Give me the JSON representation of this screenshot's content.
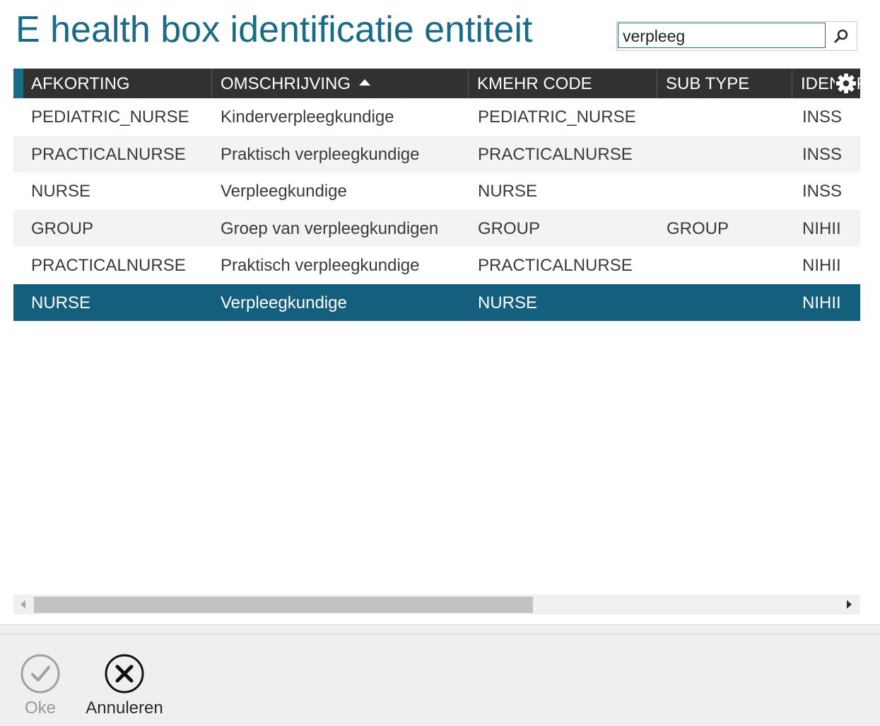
{
  "title": "E health box identificatie entiteit",
  "search": {
    "value": "verpleeg",
    "button_icon": "search-icon"
  },
  "grid": {
    "columns": [
      {
        "label": "AFKORTING",
        "sort": ""
      },
      {
        "label": "OMSCHRIJVING",
        "sort": "asc"
      },
      {
        "label": "KMEHR CODE",
        "sort": ""
      },
      {
        "label": "SUB TYPE",
        "sort": ""
      },
      {
        "label": "IDENTIFICATIE",
        "sort": ""
      }
    ],
    "settings_icon": "gear-icon",
    "accent_color": "#1a6b85",
    "selected_color": "#145f7d",
    "rows": [
      {
        "afkorting": "PEDIATRIC_NURSE",
        "omschrijving": "Kinderverpleegkundige",
        "kmehr_code": "PEDIATRIC_NURSE",
        "sub_type": "",
        "identificatie": "INSS"
      },
      {
        "afkorting": "PRACTICALNURSE",
        "omschrijving": "Praktisch verpleegkundige",
        "kmehr_code": "PRACTICALNURSE",
        "sub_type": "",
        "identificatie": "INSS"
      },
      {
        "afkorting": "NURSE",
        "omschrijving": "Verpleegkundige",
        "kmehr_code": "NURSE",
        "sub_type": "",
        "identificatie": "INSS"
      },
      {
        "afkorting": "GROUP",
        "omschrijving": "Groep van verpleegkundigen",
        "kmehr_code": "GROUP",
        "sub_type": "GROUP",
        "identificatie": "NIHII"
      },
      {
        "afkorting": "PRACTICALNURSE",
        "omschrijving": "Praktisch verpleegkundige",
        "kmehr_code": "PRACTICALNURSE",
        "sub_type": "",
        "identificatie": "NIHII"
      },
      {
        "afkorting": "NURSE",
        "omschrijving": "Verpleegkundige",
        "kmehr_code": "NURSE",
        "sub_type": "",
        "identificatie": "NIHII",
        "selected": true
      }
    ]
  },
  "footer": {
    "ok_label": "Oke",
    "ok_enabled": false,
    "ok_icon": "checkmark-circle-icon",
    "cancel_label": "Annuleren",
    "cancel_icon": "close-circle-icon"
  }
}
